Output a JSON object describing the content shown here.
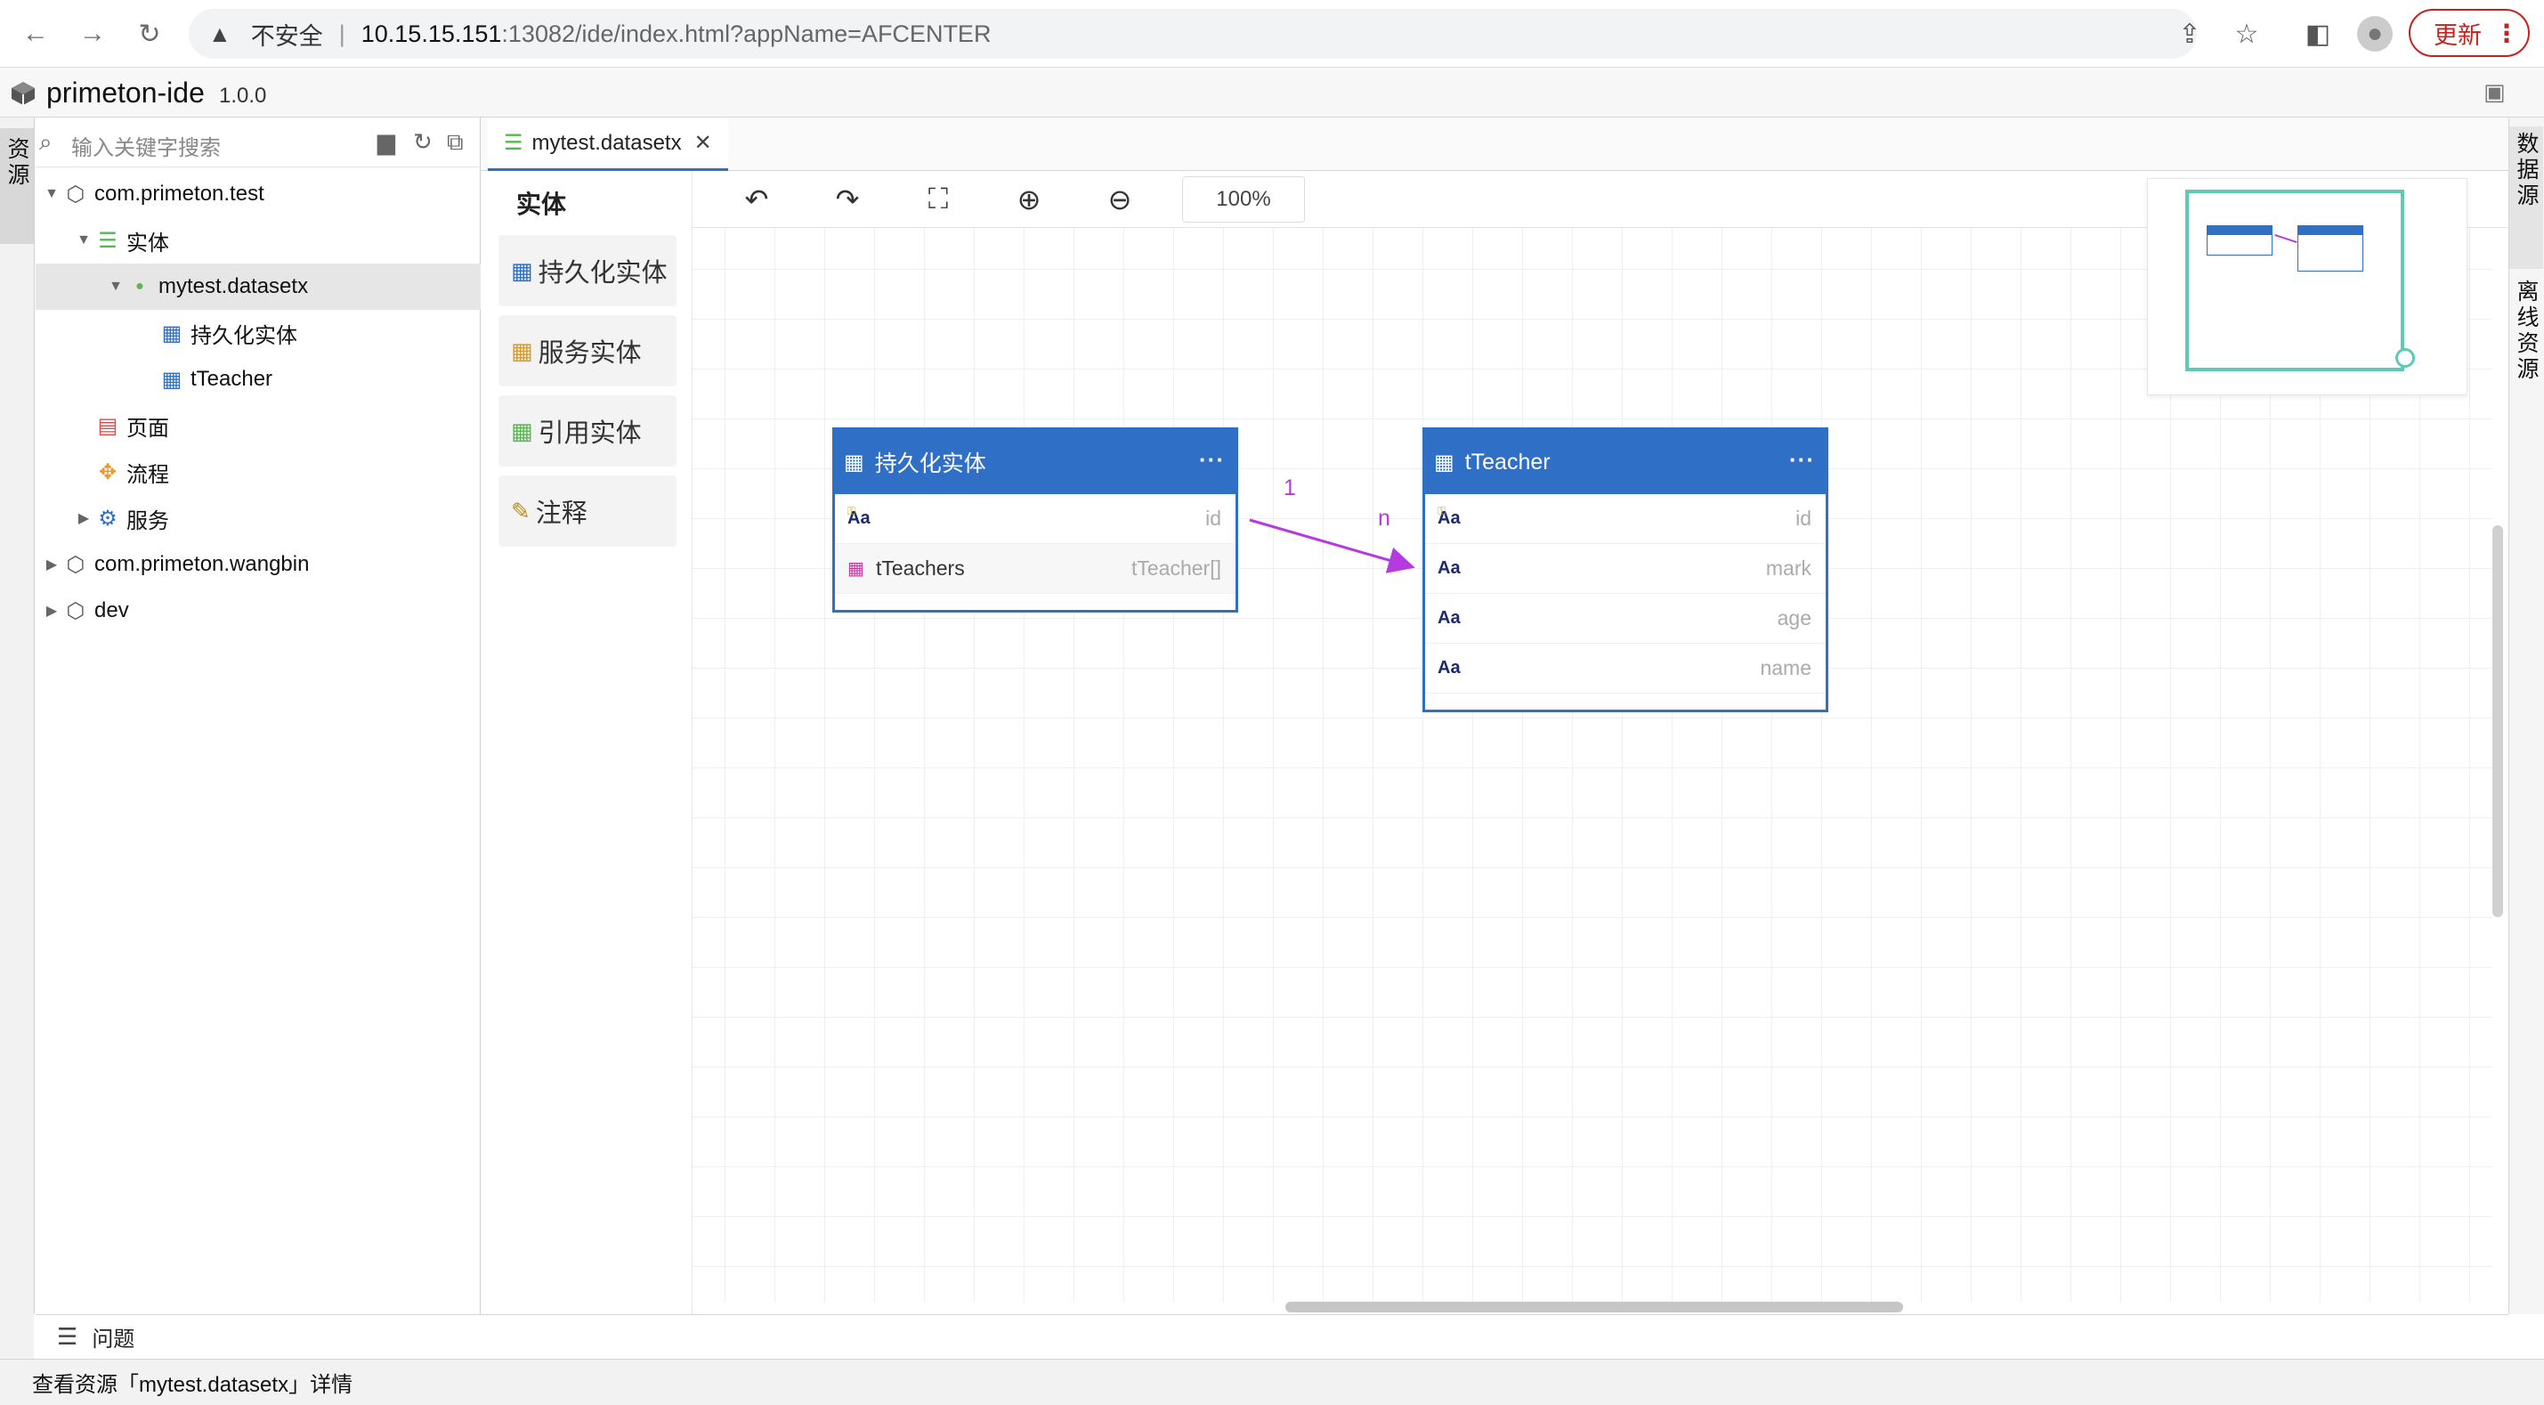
{
  "browser": {
    "security_label": "不安全",
    "url_host": "10.15.15.151",
    "url_path": ":13082/ide/index.html?appName=AFCENTER",
    "update_label": "更新"
  },
  "app": {
    "name": "primeton-ide",
    "version": "1.0.0"
  },
  "left_tab": "资源",
  "right_tabs": [
    "数据源",
    "离线资源"
  ],
  "search": {
    "placeholder": "输入关键字搜索"
  },
  "tree": [
    {
      "label": "com.primeton.test",
      "icon": "package-icon",
      "expanded": true
    },
    {
      "label": "实体",
      "icon": "database-icon",
      "expanded": true
    },
    {
      "label": "mytest.datasetx",
      "icon": "dot-icon",
      "expanded": true,
      "selected": true
    },
    {
      "label": "持久化实体",
      "icon": "table-icon"
    },
    {
      "label": "tTeacher",
      "icon": "table-icon"
    },
    {
      "label": "页面",
      "icon": "page-icon"
    },
    {
      "label": "流程",
      "icon": "flow-icon"
    },
    {
      "label": "服务",
      "icon": "gear-icon",
      "expanded": false
    },
    {
      "label": "com.primeton.wangbin",
      "icon": "package-icon",
      "expanded": false
    },
    {
      "label": "dev",
      "icon": "package-icon",
      "expanded": false
    }
  ],
  "editor_tab": {
    "label": "mytest.datasetx"
  },
  "palette": {
    "title": "实体",
    "items": [
      "持久化实体",
      "服务实体",
      "引用实体",
      "注释"
    ]
  },
  "toolbar": {
    "zoom": "100%"
  },
  "entities": [
    {
      "title": "持久化实体",
      "fields": [
        {
          "type_icon": "Aa",
          "name": "",
          "type": "id",
          "key": true
        },
        {
          "type_icon": "grid",
          "name": "tTeachers",
          "type": "tTeacher[]"
        }
      ]
    },
    {
      "title": "tTeacher",
      "fields": [
        {
          "type_icon": "Aa",
          "name": "",
          "type": "id",
          "key": true
        },
        {
          "type_icon": "Aa",
          "name": "",
          "type": "mark"
        },
        {
          "type_icon": "Aa",
          "name": "",
          "type": "age"
        },
        {
          "type_icon": "Aa",
          "name": "",
          "type": "name"
        }
      ]
    }
  ],
  "relation": {
    "source_card": "1",
    "target_card": "n",
    "color": "#b53ae0"
  },
  "colors": {
    "accent": "#2f6fc6",
    "minimap": "#5fc9b8",
    "update": "#c5221f"
  },
  "bottom": {
    "problems_label": "问题",
    "status_text": "查看资源「mytest.datasetx」详情"
  }
}
